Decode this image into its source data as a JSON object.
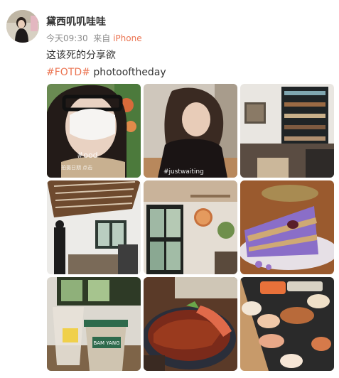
{
  "post": {
    "username": "黛西叽叽哇哇",
    "time": "今天09:30",
    "source_prefix": "来自",
    "source_device": "iPhone",
    "text": "这该死的分享欲",
    "hashtag": "#FOTD#",
    "tag_text": "photooftheday"
  },
  "photos": [
    {
      "name": "selfie-mask-photo",
      "overlay_text": "#ood",
      "sub_text": "拍摄日期 点击"
    },
    {
      "name": "girl-at-table-photo",
      "overlay_text": "#justwaiting"
    },
    {
      "name": "cafe-shelves-photo"
    },
    {
      "name": "cafe-ceiling-photo"
    },
    {
      "name": "cafe-window-photo"
    },
    {
      "name": "purple-cake-photo"
    },
    {
      "name": "iced-drinks-photo",
      "cup_text": "BAM YANG"
    },
    {
      "name": "eel-rice-bowl-photo"
    },
    {
      "name": "sushi-platter-photo"
    }
  ]
}
